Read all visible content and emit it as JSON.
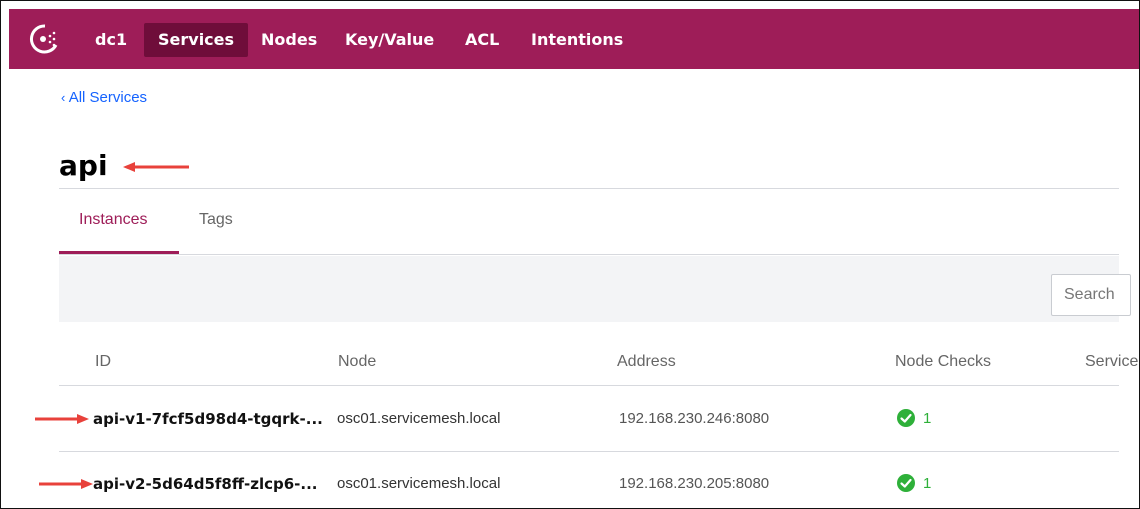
{
  "nav": {
    "datacenter": "dc1",
    "items": [
      "Services",
      "Nodes",
      "Key/Value",
      "ACL",
      "Intentions"
    ],
    "active": "Services"
  },
  "breadcrumb": "All Services",
  "service_name": "api",
  "tabs": [
    "Instances",
    "Tags"
  ],
  "active_tab": "Instances",
  "search": {
    "placeholder": "Search"
  },
  "table": {
    "headers": [
      "ID",
      "Node",
      "Address",
      "Node Checks",
      "Service"
    ],
    "rows": [
      {
        "id": "api-v1-7fcf5d98d4-tgqrk-...",
        "node": "osc01.servicemesh.local",
        "address": "192.168.230.246:8080",
        "node_checks": "1"
      },
      {
        "id": "api-v2-5d64d5f8ff-zlcp6-...",
        "node": "osc01.servicemesh.local",
        "address": "192.168.230.205:8080",
        "node_checks": "1"
      }
    ]
  },
  "colors": {
    "brand": "#9e1d58",
    "brand_dark": "#6f0d3a",
    "link": "#1563ff",
    "passing": "#2eb039",
    "annotation_arrow": "#e8413b"
  }
}
